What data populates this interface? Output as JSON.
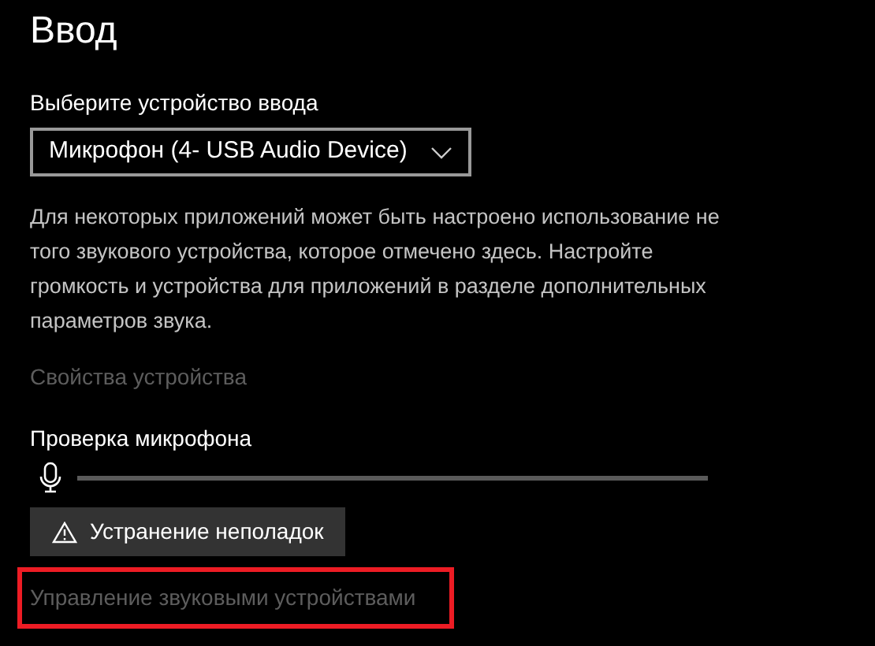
{
  "title": "Ввод",
  "device_select": {
    "label": "Выберите устройство ввода",
    "value": "Микрофон (4- USB Audio Device)"
  },
  "note": "Для некоторых приложений может быть настроено использование не того звукового устройства, которое отмечено здесь. Настройте громкость и устройства для приложений в разделе дополнительных параметров звука.",
  "device_properties_link": {
    "label": "Свойства устройства",
    "disabled": true,
    "highlighted": false
  },
  "mic_test": {
    "label": "Проверка микрофона",
    "level": 0
  },
  "troubleshoot_button": {
    "label": "Устранение неполадок"
  },
  "manage_devices_link": {
    "label": "Управление звуковыми устройствами",
    "disabled": true,
    "highlighted": true
  }
}
